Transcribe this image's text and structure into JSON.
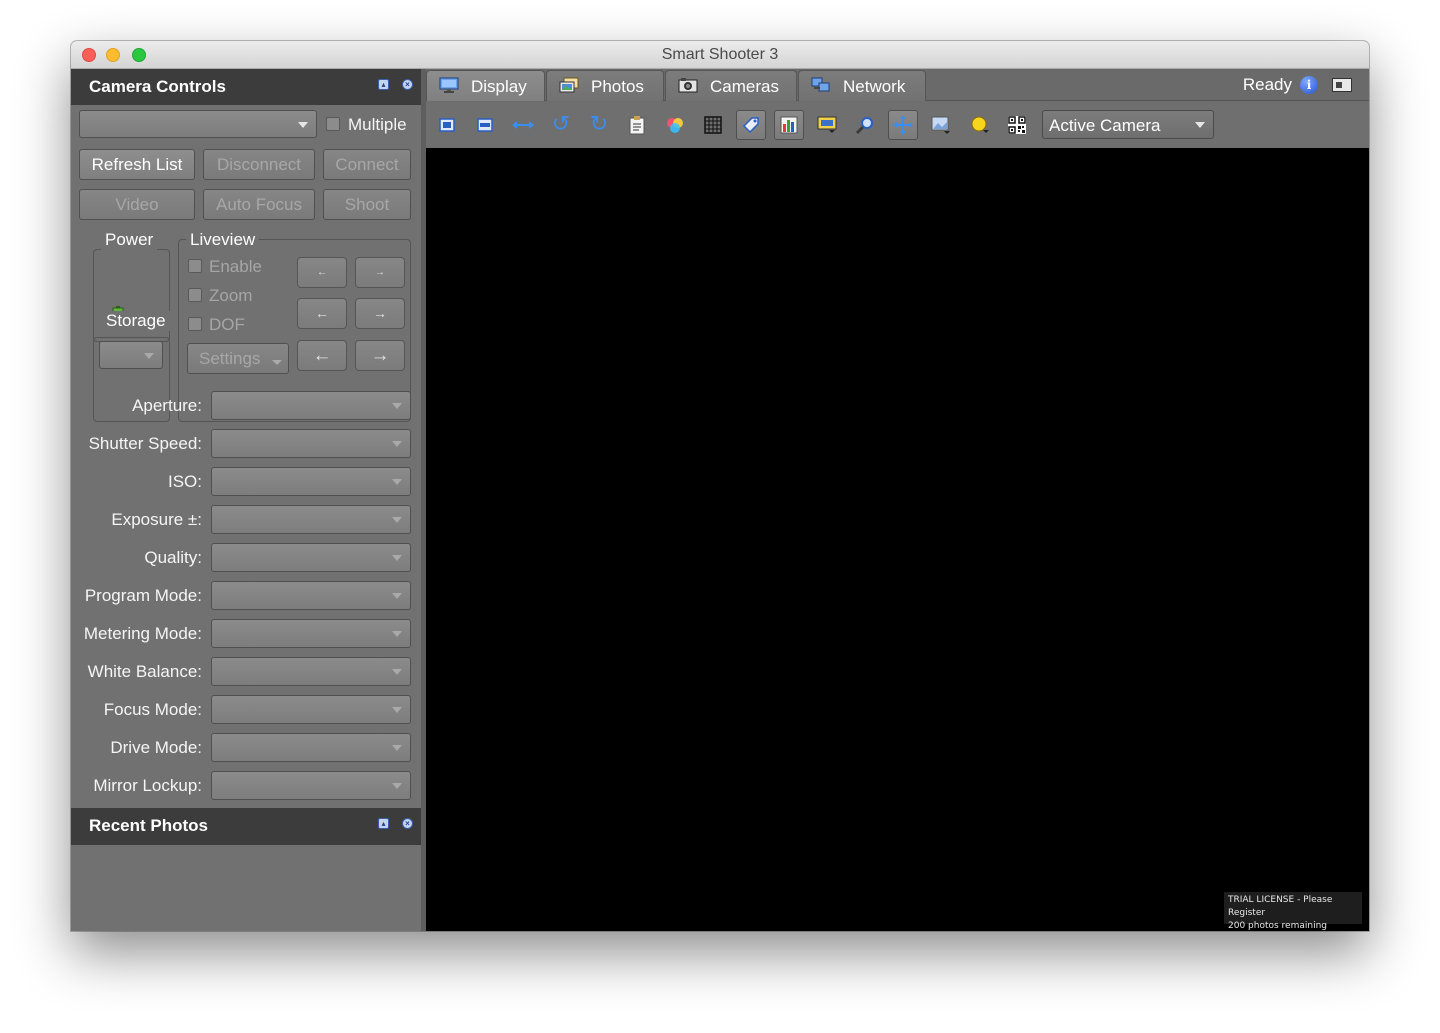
{
  "window": {
    "title": "Smart Shooter 3"
  },
  "camera_controls": {
    "title": "Camera Controls",
    "camera_selected": "",
    "multiple_label": "Multiple",
    "buttons": {
      "refresh": "Refresh List",
      "disconnect": "Disconnect",
      "connect": "Connect",
      "video": "Video",
      "auto_focus": "Auto Focus",
      "shoot": "Shoot"
    },
    "power_label": "Power",
    "storage_label": "Storage",
    "storage_value": "",
    "liveview": {
      "title": "Liveview",
      "enable": "Enable",
      "zoom": "Zoom",
      "dof": "DOF",
      "settings": "Settings"
    },
    "settings": [
      {
        "label": "Aperture:",
        "value": ""
      },
      {
        "label": "Shutter Speed:",
        "value": ""
      },
      {
        "label": "ISO:",
        "value": ""
      },
      {
        "label": "Exposure ±:",
        "value": ""
      },
      {
        "label": "Quality:",
        "value": ""
      },
      {
        "label": "Program Mode:",
        "value": ""
      },
      {
        "label": "Metering Mode:",
        "value": ""
      },
      {
        "label": "White Balance:",
        "value": ""
      },
      {
        "label": "Focus Mode:",
        "value": ""
      },
      {
        "label": "Drive Mode:",
        "value": ""
      },
      {
        "label": "Mirror Lockup:",
        "value": ""
      }
    ]
  },
  "recent_photos": {
    "title": "Recent Photos"
  },
  "tabs": [
    {
      "label": "Display",
      "icon": "monitor-icon"
    },
    {
      "label": "Photos",
      "icon": "photos-icon"
    },
    {
      "label": "Cameras",
      "icon": "camera-icon"
    },
    {
      "label": "Network",
      "icon": "network-icon"
    }
  ],
  "status": {
    "text": "Ready"
  },
  "toolbar": {
    "active_camera": "Active Camera",
    "icons": [
      "fit-window-icon",
      "actual-size-icon",
      "fit-width-icon",
      "rotate-left-icon",
      "rotate-right-icon",
      "clipboard-icon",
      "color-wheel-icon",
      "grid-icon",
      "tag-icon",
      "histogram-icon",
      "overlay-icon",
      "zoom-icon",
      "pan-icon",
      "image-compare-icon",
      "light-bulb-icon",
      "qr-code-icon"
    ]
  },
  "display": {
    "license_line1": "TRIAL LICENSE - Please Register",
    "license_line2": "200 photos remaining"
  },
  "colors": {
    "panel_bg": "#717171",
    "header_bg": "#3c3c3c",
    "display_bg": "#000000",
    "accent_blue": "#2f6fd6"
  }
}
